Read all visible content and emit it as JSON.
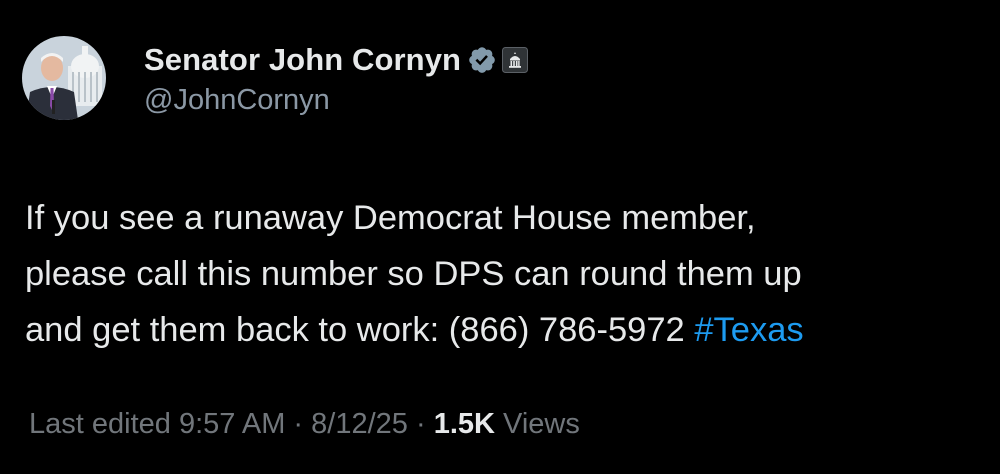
{
  "author": {
    "display_name": "Senator John Cornyn",
    "handle": "@JohnCornyn",
    "avatar_icon": "portrait-avatar",
    "verified_icon": "verified-badge-icon",
    "affiliation_icon": "government-building-icon"
  },
  "tweet": {
    "lines": [
      "If you see a runaway Democrat House member,",
      "please call this number so DPS can round them up",
      "and get them back to work: (866) 786-5972 "
    ],
    "hashtag": "#Texas"
  },
  "meta": {
    "edited_label": "Last edited",
    "time": "9:57 AM",
    "separator1": " · ",
    "date": "8/12/25",
    "separator2": "  · ",
    "views_count": "1.5K",
    "views_label": " Views"
  },
  "colors": {
    "background": "#000000",
    "text_primary": "#e7e9ea",
    "text_secondary": "#71767b",
    "link": "#1d9bf0",
    "verified": "#829aab"
  }
}
